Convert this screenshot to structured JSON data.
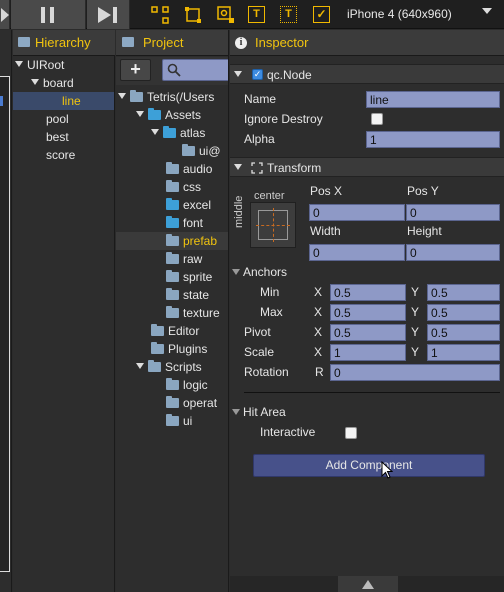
{
  "toolbar": {
    "play_icon": "play-icon",
    "pause_icon": "pause-icon",
    "step_icon": "step-icon",
    "tools": [
      "move-tool-icon",
      "rect-tool-icon",
      "camera-tool-icon",
      "text-tool-icon",
      "text-frame-tool-icon",
      "checkbox-tool-icon"
    ],
    "tool_texts": [
      "",
      "",
      "",
      "T",
      "T",
      "✓"
    ],
    "device": "iPhone 4 (640x960)"
  },
  "hierarchy": {
    "title": "Hierarchy",
    "root": "UIRoot",
    "board": "board",
    "line": "line",
    "pool": "pool",
    "best": "best",
    "score": "score"
  },
  "project": {
    "title": "Project",
    "add_label": "+",
    "root": "Tetris(/Users",
    "assets": "Assets",
    "atlas": "atlas",
    "ui_atlas": "ui@",
    "audio": "audio",
    "css": "css",
    "excel": "excel",
    "font": "font",
    "prefab": "prefab",
    "raw": "raw",
    "sprite": "sprite",
    "state": "state",
    "texture": "texture",
    "editor": "Editor",
    "plugins": "Plugins",
    "scripts": "Scripts",
    "logic": "logic",
    "operat": "operat",
    "ui": "ui"
  },
  "inspector": {
    "title": "Inspector",
    "node": {
      "header": "qc.Node",
      "name_label": "Name",
      "name_value": "line",
      "ignore_destroy_label": "Ignore Destroy",
      "alpha_label": "Alpha",
      "alpha_value": "1"
    },
    "transform": {
      "header": "Transform",
      "center": "center",
      "middle": "middle",
      "pos_x_label": "Pos X",
      "pos_x_value": "0",
      "pos_y_label": "Pos Y",
      "pos_y_value": "0",
      "width_label": "Width",
      "width_value": "0",
      "height_label": "Height",
      "height_value": "0",
      "anchors_label": "Anchors",
      "min_label": "Min",
      "max_label": "Max",
      "x": "X",
      "y": "Y",
      "r": "R",
      "min_x": "0.5",
      "min_y": "0.5",
      "max_x": "0.5",
      "max_y": "0.5",
      "pivot_label": "Pivot",
      "pivot_x": "0.5",
      "pivot_y": "0.5",
      "scale_label": "Scale",
      "scale_x": "1",
      "scale_y": "1",
      "rotation_label": "Rotation",
      "rotation_value": "0"
    },
    "hit_area": {
      "header": "Hit Area",
      "interactive_label": "Interactive"
    },
    "add_component": "Add Component"
  },
  "colors": {
    "accent": "#f1c40f",
    "field": "#8e99c6",
    "selection": "#3a4a6a"
  }
}
